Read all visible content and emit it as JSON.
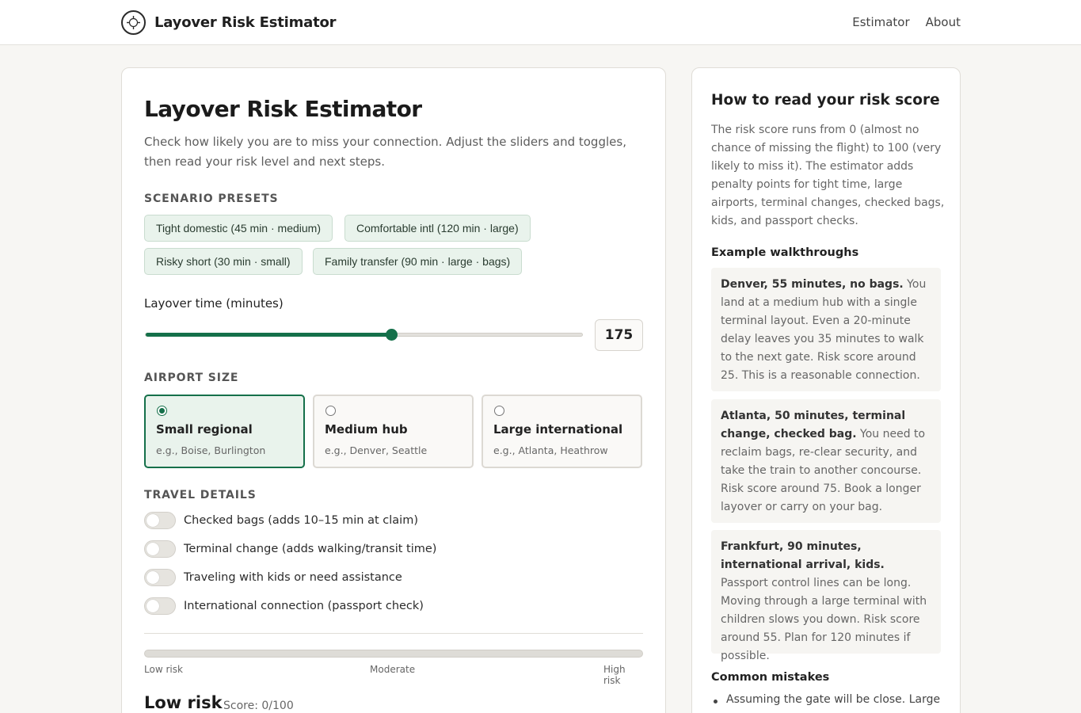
{
  "header": {
    "brand_title": "Layover Risk Estimator",
    "nav": [
      "Estimator",
      "About"
    ]
  },
  "main": {
    "title": "Layover Risk Estimator",
    "description": "Check how likely you are to miss your connection. Adjust the sliders and toggles, then read your risk level and next steps.",
    "presets_label": "SCENARIO PRESETS",
    "presets": [
      "Tight domestic (45 min · medium)",
      "Comfortable intl (120 min · large)",
      "Risky short (30 min · small)",
      "Family transfer (90 min · large · bags)"
    ],
    "layover_label": "Layover time (minutes)",
    "layover_value": "175",
    "layover_fraction": 0.56,
    "airport_label": "AIRPORT SIZE",
    "airport_options": [
      {
        "name": "Small regional",
        "example": "e.g., Boise, Burlington",
        "selected": true
      },
      {
        "name": "Medium hub",
        "example": "e.g., Denver, Seattle",
        "selected": false
      },
      {
        "name": "Large international",
        "example": "e.g., Atlanta, Heathrow",
        "selected": false
      }
    ],
    "travel_label": "TRAVEL DETAILS",
    "toggles": [
      "Checked bags (adds 10–15 min at claim)",
      "Terminal change (adds walking/transit time)",
      "Traveling with kids or need assistance",
      "International connection (passport check)"
    ],
    "risk_ticks": [
      "Low risk",
      "Moderate",
      "High risk"
    ],
    "risk_score_value": 0,
    "risk_level": "Low risk",
    "risk_score": "Score: 0/100"
  },
  "side": {
    "title": "How to read your risk score",
    "description": "The risk score runs from 0 (almost no chance of missing the flight) to 100 (very likely to miss it). The estimator adds penalty points for tight time, large airports, terminal changes, checked bags, kids, and passport checks.",
    "examples_title": "Example walkthroughs",
    "examples": [
      {
        "lead": "Denver, 55 minutes, no bags.",
        "body": " You land at a medium hub with a single terminal layout. Even a 20-minute delay leaves you 35 minutes to walk to the next gate. Risk score around 25. This is a reasonable connection."
      },
      {
        "lead": "Atlanta, 50 minutes, terminal change, checked bag.",
        "body": " You need to reclaim bags, re-clear security, and take the train to another concourse. Risk score around 75. Book a longer layover or carry on your bag."
      },
      {
        "lead": "Frankfurt, 90 minutes, international arrival, kids.",
        "body": " Passport control lines can be long. Moving through a large terminal with children slows you down. Risk score around 55. Plan for 120 minutes if possible."
      }
    ],
    "mistakes_title": "Common mistakes",
    "mistakes": [
      "Assuming the gate will be close. Large"
    ]
  },
  "colors": {
    "accent": "#15704a",
    "preset_bg": "#e9f3ec"
  }
}
